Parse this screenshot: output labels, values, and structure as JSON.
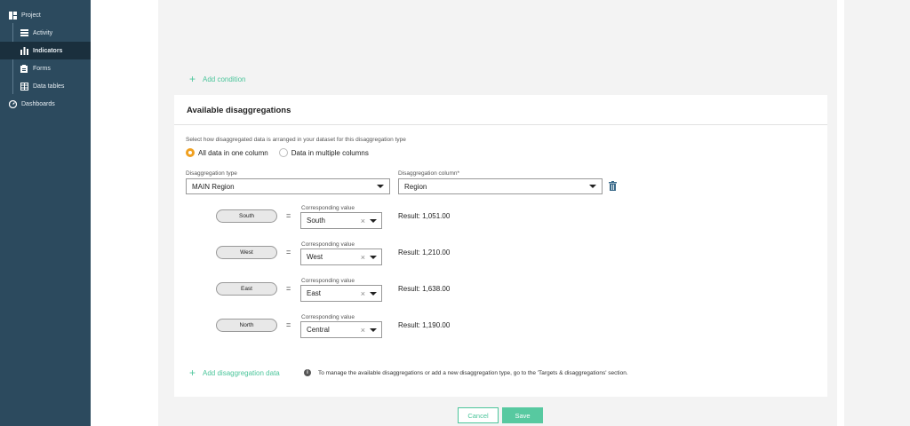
{
  "sidebar": {
    "project_label": "Project",
    "items": [
      {
        "label": "Activity",
        "icon": "list-icon"
      },
      {
        "label": "Indicators",
        "icon": "bar-chart-icon",
        "active": true
      },
      {
        "label": "Forms",
        "icon": "clipboard-icon"
      },
      {
        "label": "Data tables",
        "icon": "table-icon"
      }
    ],
    "dashboards_label": "Dashboards"
  },
  "conditions": {
    "add_label": "Add condition"
  },
  "disaggregations": {
    "title": "Available disaggregations",
    "hint": "Select how disaggregated data is arranged in your dataset for this disaggregation type",
    "options": [
      {
        "label": "All data in one column",
        "checked": true
      },
      {
        "label": "Data in multiple columns",
        "checked": false
      }
    ],
    "type_label": "Disaggregation type",
    "type_value": "MAIN Region",
    "column_label": "Disaggregation column*",
    "column_value": "Region",
    "corresponding_label": "Corresponding value",
    "rows": [
      {
        "name": "South",
        "value": "South",
        "result": "Result: 1,051.00"
      },
      {
        "name": "West",
        "value": "West",
        "result": "Result: 1,210.00"
      },
      {
        "name": "East",
        "value": "East",
        "result": "Result: 1,638.00"
      },
      {
        "name": "North",
        "value": "Central",
        "result": "Result: 1,190.00"
      }
    ],
    "add_label": "Add disaggregation data",
    "info_text": "To manage the available disaggregations or add a new disaggregation type, go to the 'Targets & disaggregations' section."
  },
  "footer": {
    "cancel_label": "Cancel",
    "save_label": "Save"
  },
  "colors": {
    "sidebar": "#2c4a5e",
    "accent": "#4cc59b",
    "radio": "#f0a020"
  }
}
